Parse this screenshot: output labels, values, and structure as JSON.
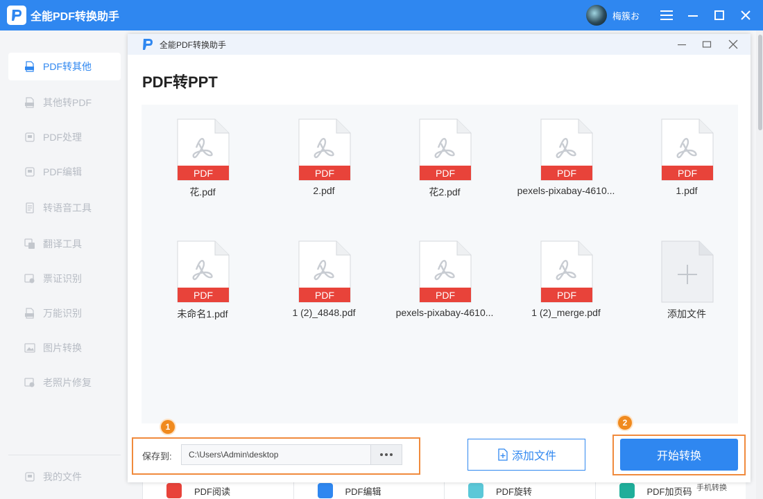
{
  "app": {
    "title": "全能PDF转换助手",
    "username": "梅簇お",
    "accent_color": "#2f87f0"
  },
  "sidebar": {
    "items": [
      {
        "label": "PDF转其他",
        "icon": "pdf-icon",
        "active": true
      },
      {
        "label": "其他转PDF",
        "icon": "pdf-icon"
      },
      {
        "label": "PDF处理",
        "icon": "pdf-process-icon"
      },
      {
        "label": "PDF编辑",
        "icon": "pdf-edit-icon"
      },
      {
        "label": "转语音工具",
        "icon": "document-icon"
      },
      {
        "label": "翻译工具",
        "icon": "translate-icon"
      },
      {
        "label": "票证识别",
        "icon": "id-card-icon"
      },
      {
        "label": "万能识别",
        "icon": "pdf-icon"
      },
      {
        "label": "图片转换",
        "icon": "image-icon"
      },
      {
        "label": "老照片修复",
        "icon": "photo-icon"
      }
    ],
    "my_files": "我的文件"
  },
  "background_tools": {
    "items": [
      "PDF阅读",
      "PDF编辑",
      "PDF旋转",
      "PDF加页码"
    ],
    "phone_convert": "手机转换"
  },
  "dialog": {
    "title": "全能PDF转换助手",
    "heading": "PDF转PPT",
    "file_badge": "PDF",
    "files": [
      "花.pdf",
      "2.pdf",
      "花2.pdf",
      "pexels-pixabay-4610...",
      "1.pdf",
      "未命名1.pdf",
      "1 (2)_4848.pdf",
      "pexels-pixabay-4610...",
      "1 (2)_merge.pdf"
    ],
    "add_tile_label": "添加文件",
    "save_label": "保存到:",
    "save_path": "C:\\Users\\Admin\\desktop",
    "add_button": "添加文件",
    "start_button": "开始转换",
    "step_badges": [
      "1",
      "2"
    ],
    "highlight_color": "#f08a3c"
  }
}
